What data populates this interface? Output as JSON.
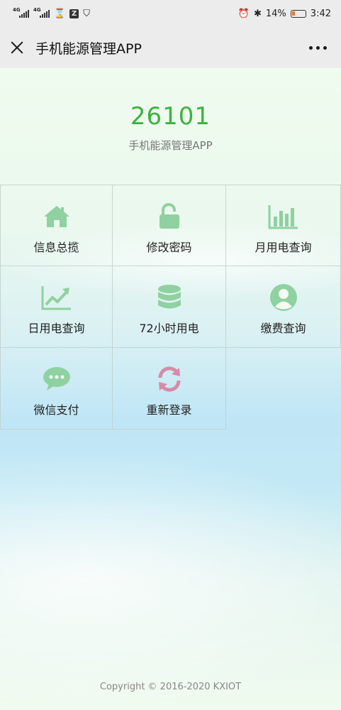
{
  "status_bar": {
    "network_1": "4G",
    "network_2": "4G",
    "app_icon": "Z",
    "battery_percent": "14%",
    "time": "3:42",
    "icons": [
      "signal-icon",
      "hourglass-icon",
      "shield-icon",
      "alarm-icon",
      "bluetooth-icon",
      "battery-icon"
    ]
  },
  "navbar": {
    "title": "手机能源管理APP"
  },
  "header": {
    "code": "26101",
    "subtitle": "手机能源管理APP"
  },
  "menu": [
    {
      "label": "信息总揽",
      "icon": "home-icon",
      "color": "#8fd1a0"
    },
    {
      "label": "修改密码",
      "icon": "unlock-icon",
      "color": "#8fd1a0"
    },
    {
      "label": "月用电查询",
      "icon": "bar-chart-icon",
      "color": "#8fd1a0"
    },
    {
      "label": "日用电查询",
      "icon": "trend-chart-icon",
      "color": "#8fd1a0"
    },
    {
      "label": "72小时用电",
      "icon": "database-icon",
      "color": "#8fd1a0"
    },
    {
      "label": "缴费查询",
      "icon": "user-icon",
      "color": "#8fd1a0"
    },
    {
      "label": "微信支付",
      "icon": "chat-icon",
      "color": "#8fd1a0"
    },
    {
      "label": "重新登录",
      "icon": "refresh-icon",
      "color": "#d98aa8"
    }
  ],
  "footer": {
    "copyright": "Copyright © 2016-2020 KXIOT"
  },
  "colors": {
    "accent_green": "#3cb33c",
    "icon_green": "#8fd1a0",
    "icon_pink": "#d98aa8"
  }
}
